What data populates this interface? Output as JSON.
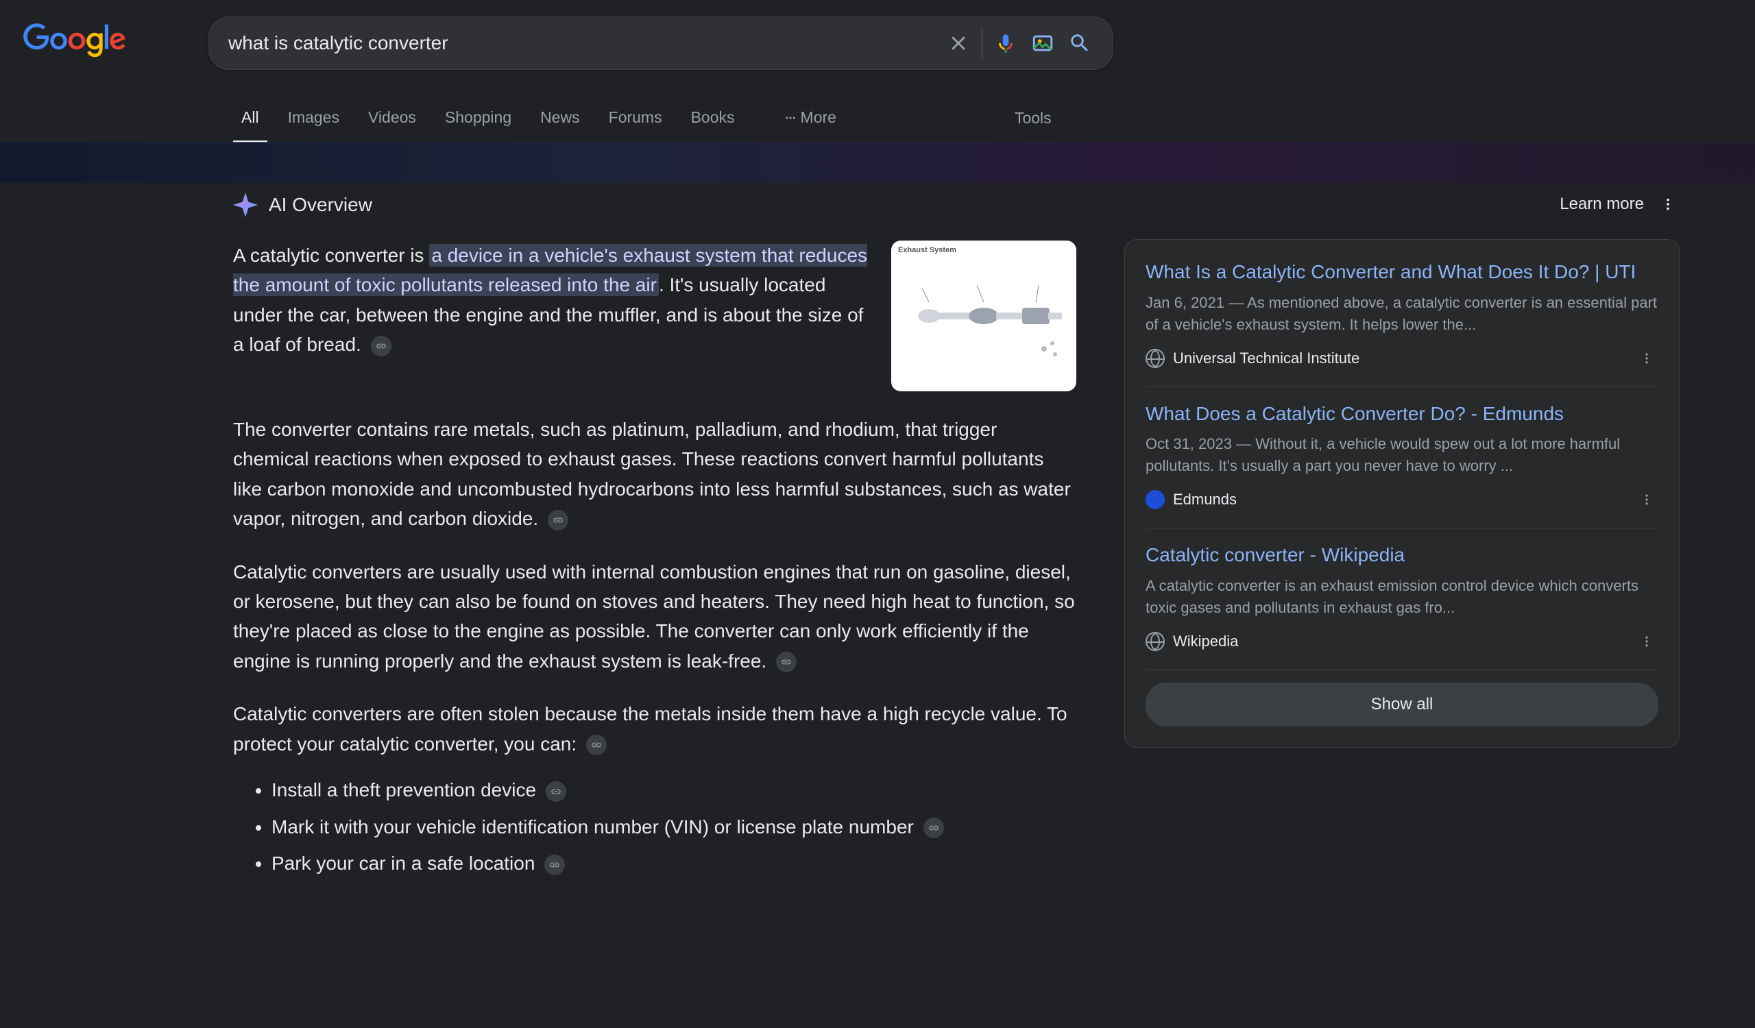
{
  "search": {
    "query": "what is catalytic converter"
  },
  "tabs": {
    "items": [
      "All",
      "Images",
      "Videos",
      "Shopping",
      "News",
      "Forums",
      "Books"
    ],
    "active": 0,
    "more_label": "More",
    "tools_label": "Tools"
  },
  "ai_overview": {
    "badge": "AI Overview",
    "learn_more": "Learn more",
    "lead_plain": "A catalytic converter is ",
    "lead_highlight": "a device in a vehicle's exhaust system that reduces the amount of toxic pollutants released into the air",
    "lead_tail": ". It's usually located under the car, between the engine and the muffler, and is about the size of a loaf of bread.",
    "diagram_label": "Exhaust System",
    "para2": "The converter contains rare metals, such as platinum, palladium, and rhodium, that trigger chemical reactions when exposed to exhaust gases. These reactions convert harmful pollutants like carbon monoxide and uncombusted hydrocarbons into less harmful substances, such as water vapor, nitrogen, and carbon dioxide.",
    "para3": "Catalytic converters are usually used with internal combustion engines that run on gasoline, diesel, or kerosene, but they can also be found on stoves and heaters. They need high heat to function, so they're placed as close to the engine as possible. The converter can only work efficiently if the engine is running properly and the exhaust system is leak-free.",
    "para4": "Catalytic converters are often stolen because the metals inside them have a high recycle value. To protect your catalytic converter, you can:",
    "bullets": [
      "Install a theft prevention device",
      "Mark it with your vehicle identification number (VIN) or license plate number",
      "Park your car in a safe location"
    ]
  },
  "sources": [
    {
      "title": "What Is a Catalytic Converter and What Does It Do? | UTI",
      "date": "Jan 6, 2021",
      "snippet": "As mentioned above, a catalytic converter is an essential part of a vehicle's exhaust system. It helps lower the...",
      "site": "Universal Technical Institute",
      "favicon": "globe"
    },
    {
      "title": "What Does a Catalytic Converter Do? - Edmunds",
      "date": "Oct 31, 2023",
      "snippet": "Without it, a vehicle would spew out a lot more harmful pollutants. It's usually a part you never have to worry ...",
      "site": "Edmunds",
      "favicon": "blue"
    },
    {
      "title": "Catalytic converter - Wikipedia",
      "date": "",
      "snippet": "A catalytic converter is an exhaust emission control device which converts toxic gases and pollutants in exhaust gas fro...",
      "site": "Wikipedia",
      "favicon": "globe"
    }
  ],
  "show_all": "Show all"
}
